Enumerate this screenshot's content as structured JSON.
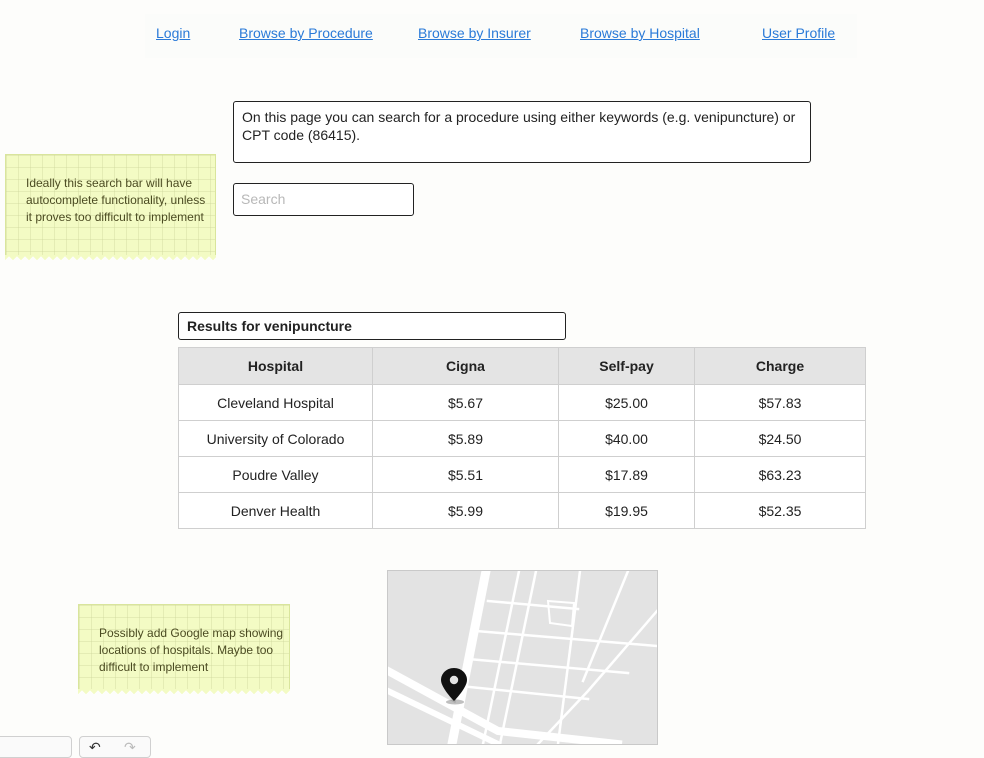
{
  "nav": {
    "items": [
      "Login",
      "Browse by Procedure",
      "Browse by Insurer",
      "Browse by Hospital",
      "User Profile"
    ],
    "link_color": "#2a7ad8"
  },
  "intro": {
    "text": "On this page you can search for a procedure using either keywords (e.g. venipuncture) or CPT code (86415)."
  },
  "search": {
    "placeholder": "Search",
    "value": ""
  },
  "notes": {
    "search_note": "Ideally this search bar will have autocomplete functionality, unless it proves too difficult to implement",
    "map_note": "Possibly add Google map showing locations of hospitals. Maybe too difficult to implement"
  },
  "results": {
    "title": "Results for venipuncture",
    "columns": [
      "Hospital",
      "Cigna",
      "Self-pay",
      "Charge"
    ],
    "rows": [
      [
        "Cleveland Hospital",
        "$5.67",
        "$25.00",
        "$57.83"
      ],
      [
        "University of Colorado",
        "$5.89",
        "$40.00",
        "$24.50"
      ],
      [
        "Poudre Valley",
        "$5.51",
        "$17.89",
        "$63.23"
      ],
      [
        "Denver Health",
        "$5.99",
        "$19.95",
        "$52.35"
      ]
    ]
  },
  "map": {
    "marker_icon": "map-pin-icon"
  },
  "toolbar": {
    "undo_icon": "undo-icon",
    "redo_icon": "redo-icon"
  },
  "colors": {
    "sticky_note": "#f3fbc4",
    "header_bg": "#e4e4e4"
  }
}
